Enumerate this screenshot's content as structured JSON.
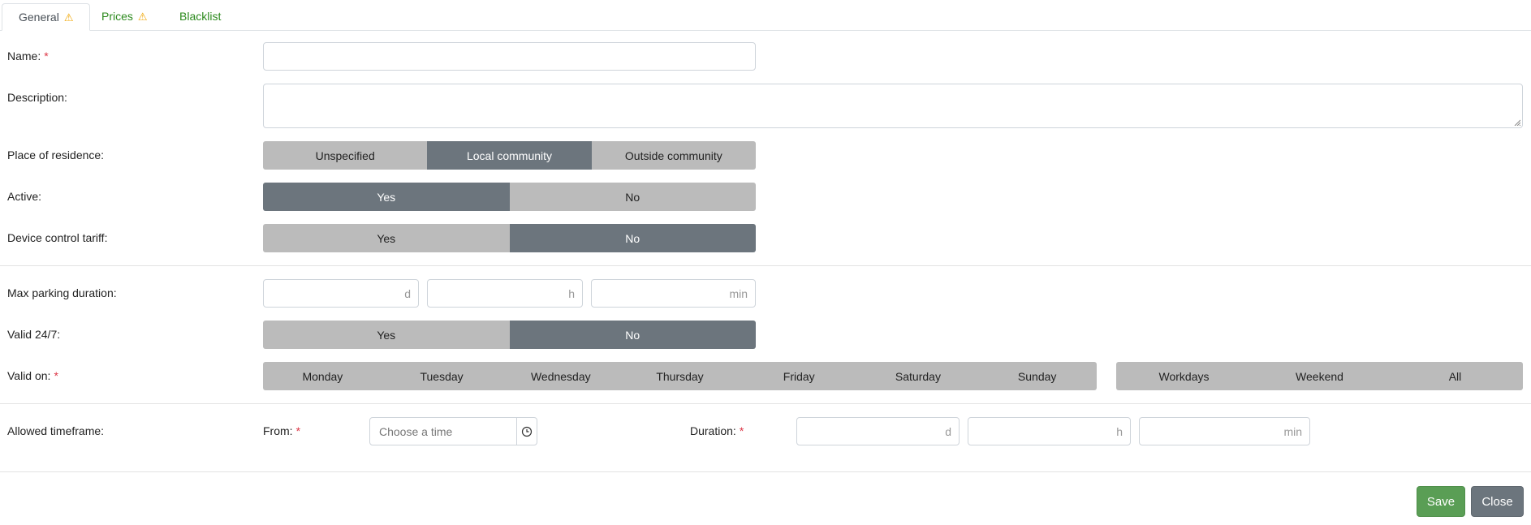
{
  "tabs": [
    {
      "label": "General",
      "warning": true,
      "active": true
    },
    {
      "label": "Prices",
      "warning": true,
      "active": false
    },
    {
      "label": "Blacklist",
      "warning": false,
      "active": false
    }
  ],
  "form": {
    "name": {
      "label": "Name:",
      "required": true,
      "value": ""
    },
    "description": {
      "label": "Description:",
      "value": ""
    },
    "residence": {
      "label": "Place of residence:",
      "options": [
        "Unspecified",
        "Local community",
        "Outside community"
      ],
      "selected": "Local community"
    },
    "active": {
      "label": "Active:",
      "options": [
        "Yes",
        "No"
      ],
      "selected": "Yes"
    },
    "device_control": {
      "label": "Device control tariff:",
      "options": [
        "Yes",
        "No"
      ],
      "selected": "No"
    },
    "max_parking": {
      "label": "Max parking duration:",
      "units": [
        "d",
        "h",
        "min"
      ]
    },
    "valid247": {
      "label": "Valid 24/7:",
      "options": [
        "Yes",
        "No"
      ],
      "selected": "No"
    },
    "valid_on": {
      "label": "Valid on:",
      "required": true,
      "days": [
        "Monday",
        "Tuesday",
        "Wednesday",
        "Thursday",
        "Friday",
        "Saturday",
        "Sunday"
      ],
      "groups": [
        "Workdays",
        "Weekend",
        "All"
      ]
    },
    "timeframe": {
      "label": "Allowed timeframe:",
      "from_label": "From:",
      "from_placeholder": "Choose a time",
      "duration_label": "Duration:",
      "duration_units": [
        "d",
        "h",
        "min"
      ]
    }
  },
  "footer": {
    "save_label": "Save",
    "close_label": "Close"
  },
  "colors": {
    "segment_on": "#6c757d",
    "segment_off": "#bbbbbb",
    "save": "#5a9e55",
    "close": "#6c757d",
    "tab_link": "#2d8a1e",
    "required": "#dc3545",
    "warning": "#f0a500"
  }
}
